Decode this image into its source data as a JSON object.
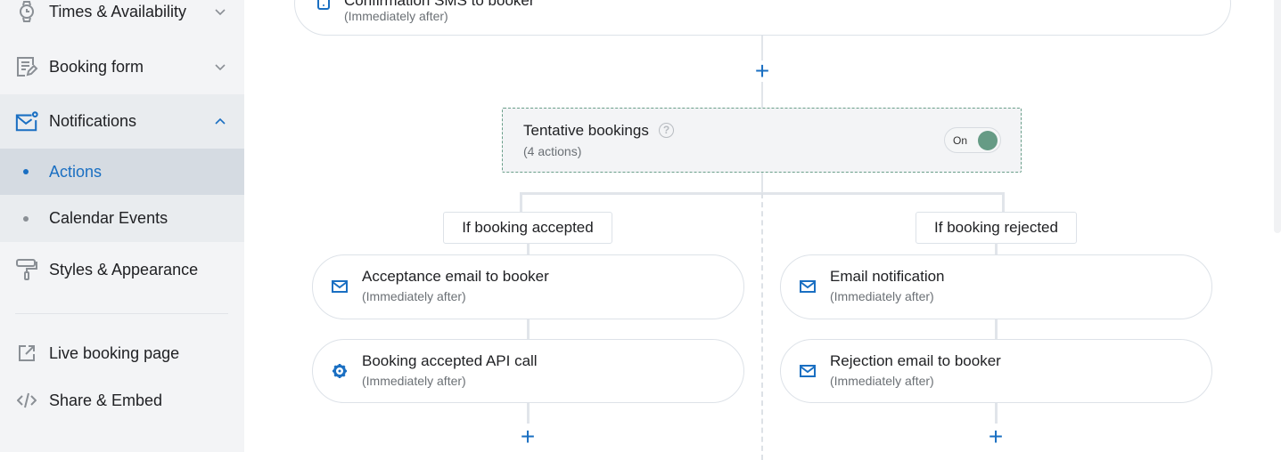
{
  "sidebar": {
    "items": [
      {
        "label": "Times & Availability",
        "icon": "watch-icon"
      },
      {
        "label": "Booking form",
        "icon": "form-edit-icon"
      },
      {
        "label": "Notifications",
        "icon": "mail-notification-icon",
        "expanded": true
      },
      {
        "label": "Actions",
        "active": true
      },
      {
        "label": "Calendar Events"
      },
      {
        "label": "Styles & Appearance",
        "icon": "paint-roller-icon"
      },
      {
        "label": "Live booking page",
        "icon": "external-link-icon"
      },
      {
        "label": "Share & Embed",
        "icon": "code-icon"
      }
    ]
  },
  "flow": {
    "top_card": {
      "title": "Confirmation SMS to booker",
      "subtitle": "(Immediately after)",
      "icon": "mobile-icon"
    },
    "tentative": {
      "title": "Tentative bookings",
      "subtitle": "(4 actions)",
      "toggle_label": "On",
      "toggle_on": true
    },
    "branches": [
      {
        "label": "If booking accepted",
        "cards": [
          {
            "title": "Acceptance email to booker",
            "subtitle": "(Immediately after)",
            "icon": "mail-icon"
          },
          {
            "title": "Booking accepted API call",
            "subtitle": "(Immediately after)",
            "icon": "gear-icon"
          }
        ]
      },
      {
        "label": "If booking rejected",
        "cards": [
          {
            "title": "Email notification",
            "subtitle": "(Immediately after)",
            "icon": "mail-icon"
          },
          {
            "title": "Rejection email to booker",
            "subtitle": "(Immediately after)",
            "icon": "mail-icon"
          }
        ]
      }
    ]
  },
  "colors": {
    "accent": "#1a6fc2",
    "toggle": "#669b85",
    "active_bg": "#d5dbe2"
  }
}
